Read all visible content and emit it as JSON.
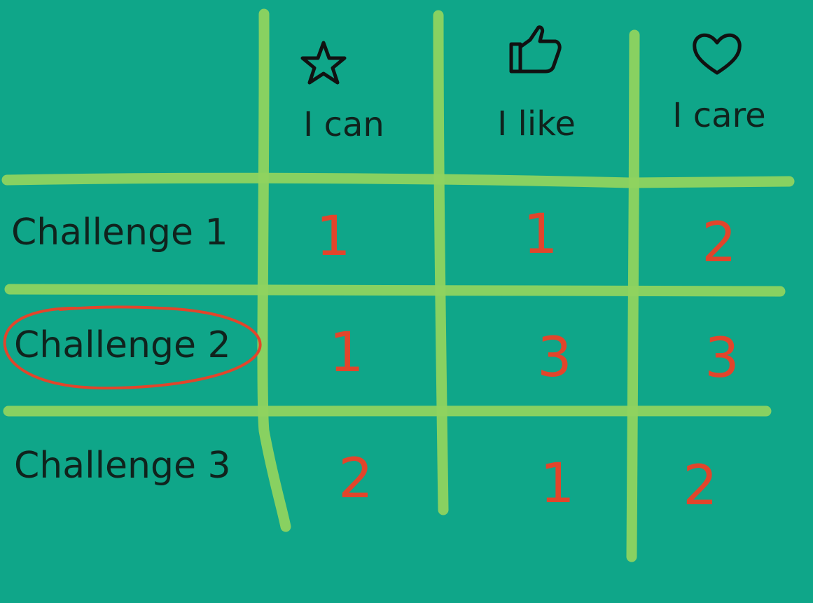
{
  "columns": [
    {
      "icon": "star-icon",
      "label": "I can"
    },
    {
      "icon": "thumbs-up-icon",
      "label": "I like"
    },
    {
      "icon": "heart-icon",
      "label": "I care"
    }
  ],
  "rows": [
    {
      "label": "Challenge 1",
      "scores": [
        "1",
        "1",
        "2"
      ],
      "highlighted": false
    },
    {
      "label": "Challenge 2",
      "scores": [
        "1",
        "3",
        "3"
      ],
      "highlighted": true
    },
    {
      "label": "Challenge 3",
      "scores": [
        "2",
        "1",
        "2"
      ],
      "highlighted": false
    }
  ],
  "colors": {
    "background": "#0fa689",
    "grid_lines": "#8fd35f",
    "text": "#10231d",
    "scores": "#e2452b",
    "highlight": "#e2452b"
  }
}
